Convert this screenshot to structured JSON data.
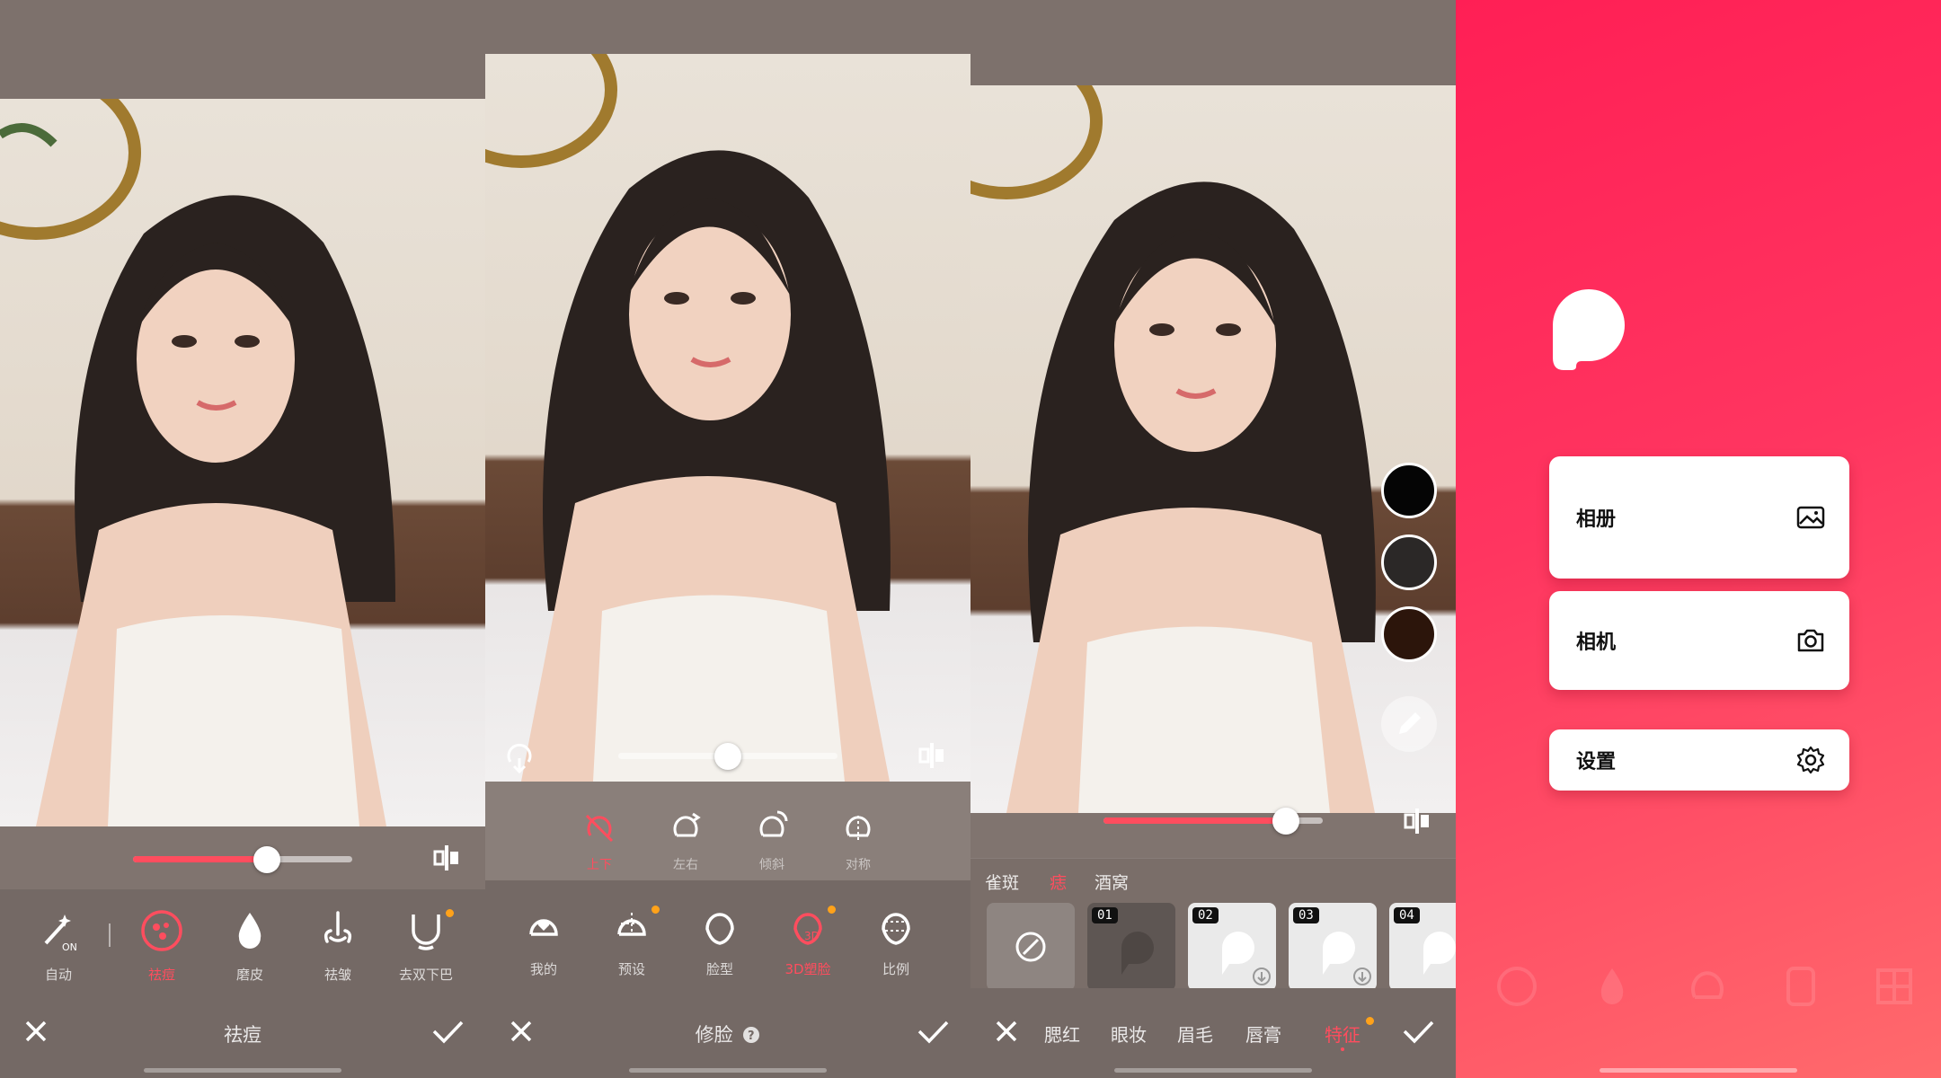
{
  "panel1": {
    "slider_value": 0.61,
    "title": "祛痘",
    "tools": [
      {
        "label": "自动",
        "icon": "magic-wand-on-icon"
      },
      {
        "label": "祛痘",
        "icon": "acne-icon",
        "active": true
      },
      {
        "label": "磨皮",
        "icon": "drop-icon"
      },
      {
        "label": "祛皱",
        "icon": "wrinkle-icon"
      },
      {
        "label": "去双下巴",
        "icon": "double-chin-icon"
      }
    ]
  },
  "panel2": {
    "slider_value": 0.5,
    "title": "修脸",
    "subtabs": [
      {
        "label": "上下",
        "active": true
      },
      {
        "label": "左右"
      },
      {
        "label": "倾斜"
      },
      {
        "label": "对称"
      }
    ],
    "tools": [
      {
        "label": "我的",
        "icon": "heart-face-icon"
      },
      {
        "label": "预设",
        "icon": "grid-face-icon"
      },
      {
        "label": "脸型",
        "icon": "face-shape-icon"
      },
      {
        "label": "3D塑脸",
        "icon": "3d-face-icon",
        "active": true
      },
      {
        "label": "比例",
        "icon": "ratio-face-icon"
      }
    ]
  },
  "panel3": {
    "slider_value": 0.83,
    "swatch_colors": [
      "#050505",
      "#2b2827",
      "#2c150b"
    ],
    "categories": [
      {
        "label": "雀斑"
      },
      {
        "label": "痣",
        "active": true
      },
      {
        "label": "酒窝"
      }
    ],
    "thumbs": [
      "01",
      "02",
      "03",
      "04"
    ],
    "makeup_tabs": [
      {
        "label": "腮红"
      },
      {
        "label": "眼妆"
      },
      {
        "label": "眉毛"
      },
      {
        "label": "唇膏"
      },
      {
        "label": "特征",
        "active": true
      }
    ]
  },
  "panel4": {
    "menu": [
      {
        "label": "相册",
        "icon": "gallery-icon"
      },
      {
        "label": "相机",
        "icon": "camera-icon"
      },
      {
        "label": "设置",
        "icon": "settings-icon"
      }
    ]
  },
  "colors": {
    "accent": "#ff4d5e",
    "badge": "#ffa21a",
    "brand_gradient_top": "#ff1f55",
    "brand_gradient_bottom": "#ff6a6c"
  }
}
